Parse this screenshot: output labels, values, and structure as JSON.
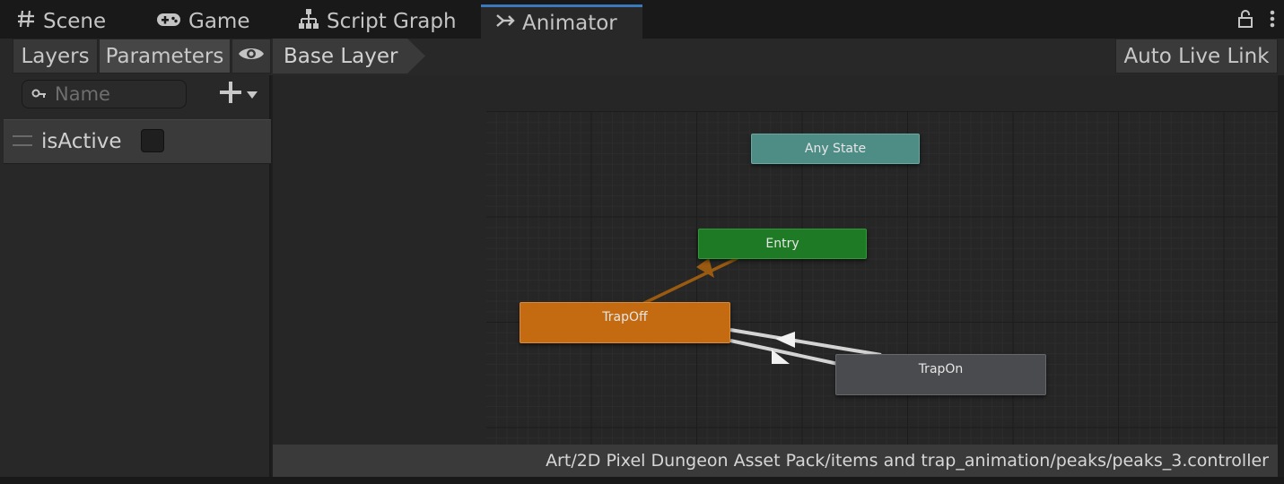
{
  "tabs": [
    {
      "label": "Scene",
      "icon": "grid-icon"
    },
    {
      "label": "Game",
      "icon": "gamepad-icon"
    },
    {
      "label": "Script Graph",
      "icon": "hierarchy-icon"
    },
    {
      "label": "Animator",
      "icon": "animator-icon"
    }
  ],
  "active_tab": "Animator",
  "toolbar": {
    "layers_label": "Layers",
    "parameters_label": "Parameters",
    "breadcrumb": "Base Layer",
    "auto_live_link_label": "Auto Live Link"
  },
  "parameters": {
    "search_placeholder": "Name",
    "items": [
      {
        "name": "isActive",
        "type": "bool",
        "value": false
      }
    ]
  },
  "states": {
    "any_state": "Any State",
    "entry": "Entry",
    "trap_off": "TrapOff",
    "trap_on": "TrapOn"
  },
  "colors": {
    "any_state": "#4e8d86",
    "entry": "#1e7a25",
    "default_state": "#c46a11",
    "state": "#4a4b4e",
    "tab_accent": "#3a79bb"
  },
  "status": {
    "path": "Art/2D Pixel Dungeon Asset Pack/items and trap_animation/peaks/peaks_3.controller"
  }
}
